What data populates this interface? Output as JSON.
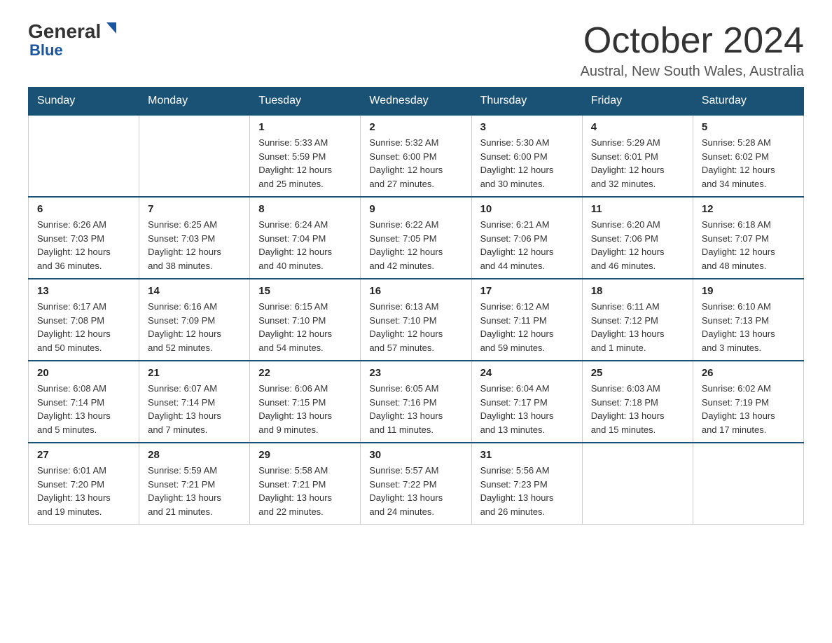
{
  "header": {
    "logo_general": "General",
    "logo_blue": "Blue",
    "month_title": "October 2024",
    "subtitle": "Austral, New South Wales, Australia"
  },
  "days_of_week": [
    "Sunday",
    "Monday",
    "Tuesday",
    "Wednesday",
    "Thursday",
    "Friday",
    "Saturday"
  ],
  "weeks": [
    [
      {
        "day": "",
        "info": ""
      },
      {
        "day": "",
        "info": ""
      },
      {
        "day": "1",
        "info": "Sunrise: 5:33 AM\nSunset: 5:59 PM\nDaylight: 12 hours\nand 25 minutes."
      },
      {
        "day": "2",
        "info": "Sunrise: 5:32 AM\nSunset: 6:00 PM\nDaylight: 12 hours\nand 27 minutes."
      },
      {
        "day": "3",
        "info": "Sunrise: 5:30 AM\nSunset: 6:00 PM\nDaylight: 12 hours\nand 30 minutes."
      },
      {
        "day": "4",
        "info": "Sunrise: 5:29 AM\nSunset: 6:01 PM\nDaylight: 12 hours\nand 32 minutes."
      },
      {
        "day": "5",
        "info": "Sunrise: 5:28 AM\nSunset: 6:02 PM\nDaylight: 12 hours\nand 34 minutes."
      }
    ],
    [
      {
        "day": "6",
        "info": "Sunrise: 6:26 AM\nSunset: 7:03 PM\nDaylight: 12 hours\nand 36 minutes."
      },
      {
        "day": "7",
        "info": "Sunrise: 6:25 AM\nSunset: 7:03 PM\nDaylight: 12 hours\nand 38 minutes."
      },
      {
        "day": "8",
        "info": "Sunrise: 6:24 AM\nSunset: 7:04 PM\nDaylight: 12 hours\nand 40 minutes."
      },
      {
        "day": "9",
        "info": "Sunrise: 6:22 AM\nSunset: 7:05 PM\nDaylight: 12 hours\nand 42 minutes."
      },
      {
        "day": "10",
        "info": "Sunrise: 6:21 AM\nSunset: 7:06 PM\nDaylight: 12 hours\nand 44 minutes."
      },
      {
        "day": "11",
        "info": "Sunrise: 6:20 AM\nSunset: 7:06 PM\nDaylight: 12 hours\nand 46 minutes."
      },
      {
        "day": "12",
        "info": "Sunrise: 6:18 AM\nSunset: 7:07 PM\nDaylight: 12 hours\nand 48 minutes."
      }
    ],
    [
      {
        "day": "13",
        "info": "Sunrise: 6:17 AM\nSunset: 7:08 PM\nDaylight: 12 hours\nand 50 minutes."
      },
      {
        "day": "14",
        "info": "Sunrise: 6:16 AM\nSunset: 7:09 PM\nDaylight: 12 hours\nand 52 minutes."
      },
      {
        "day": "15",
        "info": "Sunrise: 6:15 AM\nSunset: 7:10 PM\nDaylight: 12 hours\nand 54 minutes."
      },
      {
        "day": "16",
        "info": "Sunrise: 6:13 AM\nSunset: 7:10 PM\nDaylight: 12 hours\nand 57 minutes."
      },
      {
        "day": "17",
        "info": "Sunrise: 6:12 AM\nSunset: 7:11 PM\nDaylight: 12 hours\nand 59 minutes."
      },
      {
        "day": "18",
        "info": "Sunrise: 6:11 AM\nSunset: 7:12 PM\nDaylight: 13 hours\nand 1 minute."
      },
      {
        "day": "19",
        "info": "Sunrise: 6:10 AM\nSunset: 7:13 PM\nDaylight: 13 hours\nand 3 minutes."
      }
    ],
    [
      {
        "day": "20",
        "info": "Sunrise: 6:08 AM\nSunset: 7:14 PM\nDaylight: 13 hours\nand 5 minutes."
      },
      {
        "day": "21",
        "info": "Sunrise: 6:07 AM\nSunset: 7:14 PM\nDaylight: 13 hours\nand 7 minutes."
      },
      {
        "day": "22",
        "info": "Sunrise: 6:06 AM\nSunset: 7:15 PM\nDaylight: 13 hours\nand 9 minutes."
      },
      {
        "day": "23",
        "info": "Sunrise: 6:05 AM\nSunset: 7:16 PM\nDaylight: 13 hours\nand 11 minutes."
      },
      {
        "day": "24",
        "info": "Sunrise: 6:04 AM\nSunset: 7:17 PM\nDaylight: 13 hours\nand 13 minutes."
      },
      {
        "day": "25",
        "info": "Sunrise: 6:03 AM\nSunset: 7:18 PM\nDaylight: 13 hours\nand 15 minutes."
      },
      {
        "day": "26",
        "info": "Sunrise: 6:02 AM\nSunset: 7:19 PM\nDaylight: 13 hours\nand 17 minutes."
      }
    ],
    [
      {
        "day": "27",
        "info": "Sunrise: 6:01 AM\nSunset: 7:20 PM\nDaylight: 13 hours\nand 19 minutes."
      },
      {
        "day": "28",
        "info": "Sunrise: 5:59 AM\nSunset: 7:21 PM\nDaylight: 13 hours\nand 21 minutes."
      },
      {
        "day": "29",
        "info": "Sunrise: 5:58 AM\nSunset: 7:21 PM\nDaylight: 13 hours\nand 22 minutes."
      },
      {
        "day": "30",
        "info": "Sunrise: 5:57 AM\nSunset: 7:22 PM\nDaylight: 13 hours\nand 24 minutes."
      },
      {
        "day": "31",
        "info": "Sunrise: 5:56 AM\nSunset: 7:23 PM\nDaylight: 13 hours\nand 26 minutes."
      },
      {
        "day": "",
        "info": ""
      },
      {
        "day": "",
        "info": ""
      }
    ]
  ]
}
